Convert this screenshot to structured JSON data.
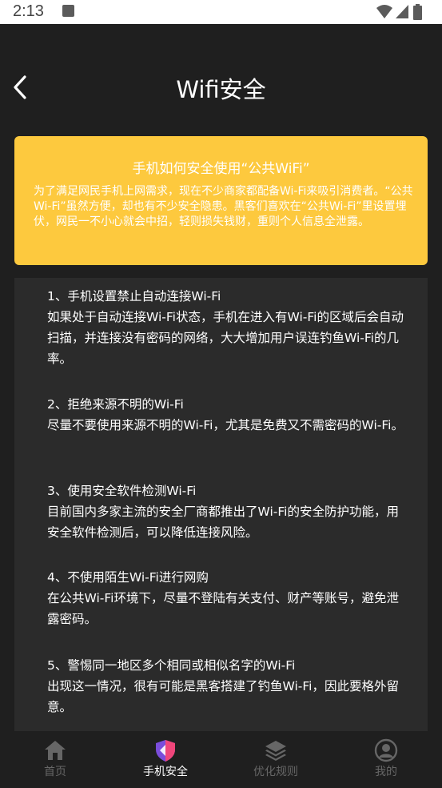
{
  "status_bar": {
    "time": "2:13"
  },
  "header": {
    "title": "Wifi安全"
  },
  "banner": {
    "title": "手机如何安全使用“公共WiFi”",
    "body": "为了满足网民手机上网需求，现在不少商家都配备Wi-Fi来吸引消费者。“公共Wi-Fi”虽然方便，却也有不少安全隐患。黑客们喜欢在“公共Wi-Fi”里设置埋伏，网民一不小心就会中招，轻则损失钱财，重则个人信息全泄露。"
  },
  "tips": [
    {
      "title": "1、手机设置禁止自动连接Wi-Fi",
      "body": "如果处于自动连接Wi-Fi状态，手机在进入有Wi-Fi的区域后会自动扫描，并连接没有密码的网络，大大增加用户误连钓鱼Wi-Fi的几率。"
    },
    {
      "title": "2、拒绝来源不明的Wi-Fi",
      "body": "尽量不要使用来源不明的Wi-Fi，尤其是免费又不需密码的Wi-Fi。"
    },
    {
      "title": "3、使用安全软件检测Wi-Fi",
      "body": "目前国内多家主流的安全厂商都推出了Wi-Fi的安全防护功能，用安全软件检测后，可以降低连接风险。"
    },
    {
      "title": "4、不使用陌生Wi-Fi进行网购",
      "body": "在公共Wi-Fi环境下，尽量不登陆有关支付、财产等账号，避免泄露密码。"
    },
    {
      "title": "5、警惕同一地区多个相同或相似名字的Wi-Fi",
      "body": "出现这一情况，很有可能是黑客搭建了钓鱼Wi-Fi，因此要格外留意。"
    }
  ],
  "tab_bar": {
    "tabs": [
      {
        "label": "首页",
        "icon": "home-icon",
        "active": false
      },
      {
        "label": "手机安全",
        "icon": "shield-icon",
        "active": true
      },
      {
        "label": "优化规则",
        "icon": "layers-icon",
        "active": false
      },
      {
        "label": "我的",
        "icon": "user-icon",
        "active": false
      }
    ]
  },
  "colors": {
    "background": "#1f1f1f",
    "banner": "#fdc93e",
    "card": "#2b2b2b",
    "tab_inactive": "#666666",
    "shield_purple": "#7a4ddb",
    "shield_pink": "#f0467a"
  }
}
